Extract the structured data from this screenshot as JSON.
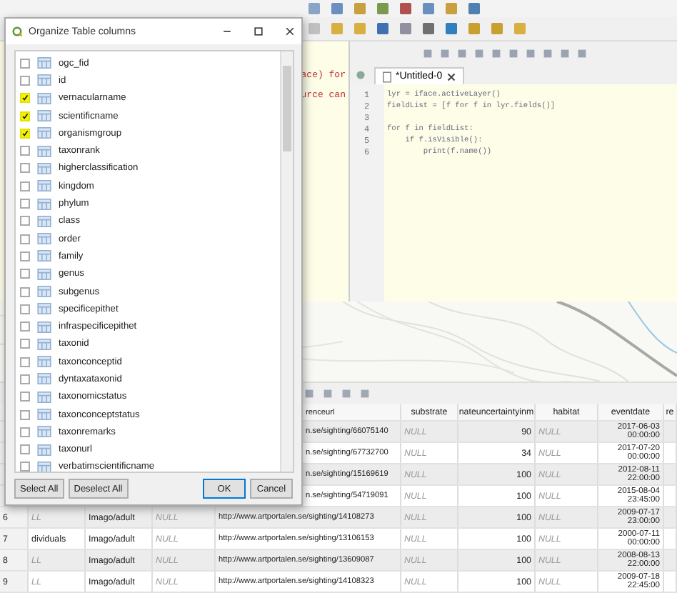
{
  "dialog": {
    "title": "Organize Table columns",
    "columns": [
      {
        "name": "ogc_fid",
        "checked": false
      },
      {
        "name": "id",
        "checked": false
      },
      {
        "name": "vernacularname",
        "checked": true
      },
      {
        "name": "scientificname",
        "checked": true
      },
      {
        "name": "organismgroup",
        "checked": true
      },
      {
        "name": "taxonrank",
        "checked": false
      },
      {
        "name": "higherclassification",
        "checked": false
      },
      {
        "name": "kingdom",
        "checked": false
      },
      {
        "name": "phylum",
        "checked": false
      },
      {
        "name": "class",
        "checked": false
      },
      {
        "name": "order",
        "checked": false
      },
      {
        "name": "family",
        "checked": false
      },
      {
        "name": "genus",
        "checked": false
      },
      {
        "name": "subgenus",
        "checked": false
      },
      {
        "name": "specificepithet",
        "checked": false
      },
      {
        "name": "infraspecificepithet",
        "checked": false
      },
      {
        "name": "taxonid",
        "checked": false
      },
      {
        "name": "taxonconceptid",
        "checked": false
      },
      {
        "name": "dyntaxataxonid",
        "checked": false
      },
      {
        "name": "taxonomicstatus",
        "checked": false
      },
      {
        "name": "taxonconceptstatus",
        "checked": false
      },
      {
        "name": "taxonremarks",
        "checked": false
      },
      {
        "name": "taxonurl",
        "checked": false
      },
      {
        "name": "verbatimscientificname",
        "checked": false
      }
    ],
    "buttons": {
      "select_all": "Select All",
      "deselect_all": "Deselect All",
      "ok": "OK",
      "cancel": "Cancel"
    }
  },
  "console": {
    "output_lines": [
      "ace) for",
      "urce can"
    ],
    "tab": "*Untitled-0",
    "lines": [
      {
        "number": "1",
        "code": "lyr = iface.activeLayer()"
      },
      {
        "number": "2",
        "code": "fieldList = [f for f in lyr.fields()]"
      },
      {
        "number": "3"
      },
      {
        "number": "4",
        "code": "for f in fieldList:"
      },
      {
        "number": "5",
        "code": "    if f.isVisible():"
      },
      {
        "number": "6",
        "code": "        print(f.name())"
      }
    ]
  },
  "table": {
    "columns": [
      "renceurl",
      "substrate",
      "nateuncertaintyinm",
      "habitat",
      "eventdate",
      "re"
    ],
    "rows": [
      {
        "url": "n.se/sighting/66075140",
        "substrate": "NULL",
        "uncertainty": "90",
        "habitat": "NULL",
        "date": "2017-06-03",
        "time": "00:00:00"
      },
      {
        "url": "n.se/sighting/67732700",
        "substrate": "NULL",
        "uncertainty": "34",
        "habitat": "NULL",
        "date": "2017-07-20",
        "time": "00:00:00"
      },
      {
        "url": "n.se/sighting/15169619",
        "substrate": "NULL",
        "uncertainty": "100",
        "habitat": "NULL",
        "date": "2012-08-11",
        "time": "22:00:00"
      },
      {
        "url": "n.se/sighting/54719091",
        "substrate": "NULL",
        "uncertainty": "100",
        "habitat": "NULL",
        "date": "2015-08-04",
        "time": "23:45:00"
      },
      {
        "number": "6",
        "col2": "LL",
        "col2_null": true,
        "col3": "Imago/adult",
        "col4": "NULL",
        "url": "http://www.artportalen.se/sighting/14108273",
        "substrate": "NULL",
        "uncertainty": "100",
        "habitat": "NULL",
        "date": "2009-07-17",
        "time": "23:00:00"
      },
      {
        "number": "7",
        "col2": "dividuals",
        "col2_null": false,
        "col3": "Imago/adult",
        "col4": "NULL",
        "url": "http://www.artportalen.se/sighting/13106153",
        "substrate": "NULL",
        "uncertainty": "100",
        "habitat": "NULL",
        "date": "2000-07-11",
        "time": "00:00:00"
      },
      {
        "number": "8",
        "col2": "LL",
        "col2_null": true,
        "col3": "Imago/adult",
        "col4": "NULL",
        "url": "http://www.artportalen.se/sighting/13609087",
        "substrate": "NULL",
        "uncertainty": "100",
        "habitat": "NULL",
        "date": "2008-08-13",
        "time": "22:00:00"
      },
      {
        "number": "9",
        "col2": "LL",
        "col2_null": true,
        "col3": "Imago/adult",
        "col4": "NULL",
        "url": "http://www.artportalen.se/sighting/14108323",
        "substrate": "NULL",
        "uncertainty": "100",
        "habitat": "NULL",
        "date": "2009-07-18",
        "time": "22:45:00"
      }
    ]
  }
}
